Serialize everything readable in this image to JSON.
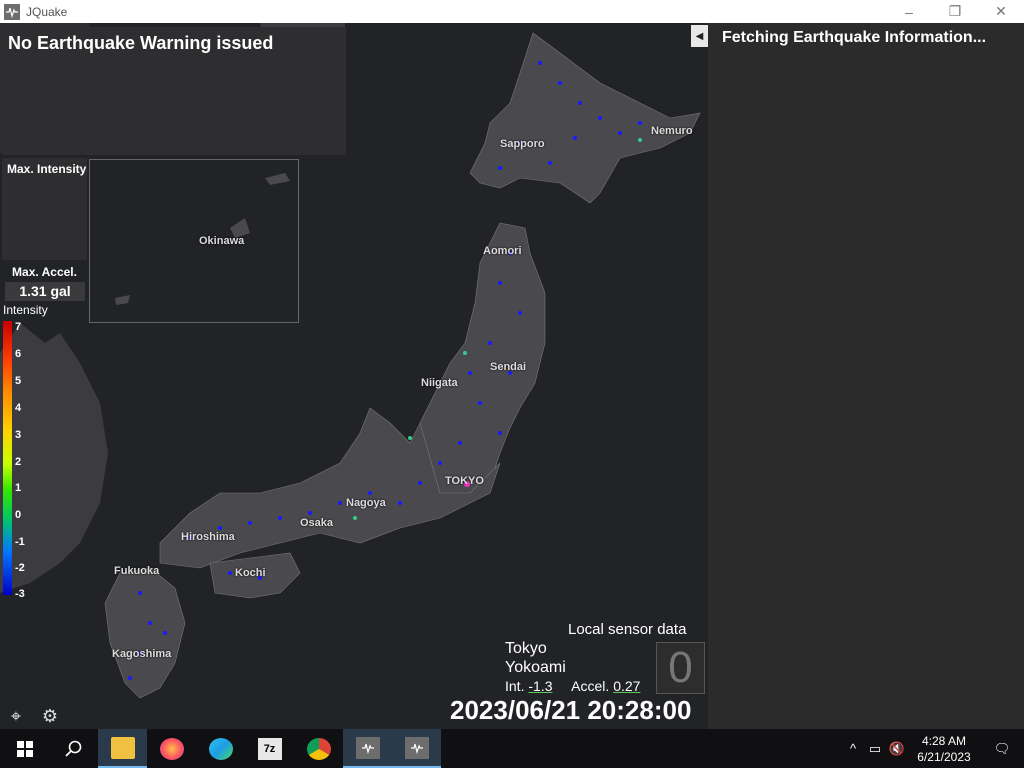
{
  "window": {
    "title": "JQuake",
    "minimize": "–",
    "maximize": "❐",
    "close": "✕"
  },
  "warning": {
    "text": "No Earthquake Warning issued"
  },
  "panel": {
    "title": "Fetching Earthquake Information...",
    "collapse_glyph": "◀"
  },
  "max_intensity": {
    "label": "Max. Intensity"
  },
  "max_accel": {
    "label": "Max. Accel.",
    "value": "1.31 gal"
  },
  "intensity_scale": {
    "title": "Intensity",
    "labels": [
      "7",
      "6",
      "5",
      "4",
      "3",
      "2",
      "1",
      "0",
      "-1",
      "-2",
      "-3"
    ]
  },
  "cities": {
    "sapporo": "Sapporo",
    "nemuro": "Nemuro",
    "aomori": "Aomori",
    "sendai": "Sendai",
    "niigata": "Niigata",
    "tokyo": "TOKYO",
    "nagoya": "Nagoya",
    "osaka": "Osaka",
    "hiroshima": "Hiroshima",
    "kochi": "Kochi",
    "fukuoka": "Fukuoka",
    "kagoshima": "Kagoshima",
    "okinawa": "Okinawa"
  },
  "sensor": {
    "title": "Local sensor data",
    "city": "Tokyo",
    "station": "Yokoami",
    "int_label": "Int.",
    "int_value": "-1.3",
    "accel_label": "Accel.",
    "accel_value": "0.27",
    "intensity_display": "0"
  },
  "datetime": "2023/06/21 20:28:00",
  "tools": {
    "locate_icon": "⌖",
    "settings_icon": "⚙"
  },
  "taskbar": {
    "start_icon": "windows-logo",
    "search_icon": "magnifier",
    "apps": [
      "file-explorer",
      "firefox",
      "edge",
      "7-zip",
      "chrome",
      "jquake",
      "jquake"
    ],
    "sevenzip_label": "7z"
  },
  "tray": {
    "time": "4:28 AM",
    "date": "6/21/2023"
  },
  "colors": {
    "map_bg": "#222326",
    "land": "#4a4a4e",
    "sensor_dot": "#1a1aff",
    "accent": "#76b9ed"
  }
}
